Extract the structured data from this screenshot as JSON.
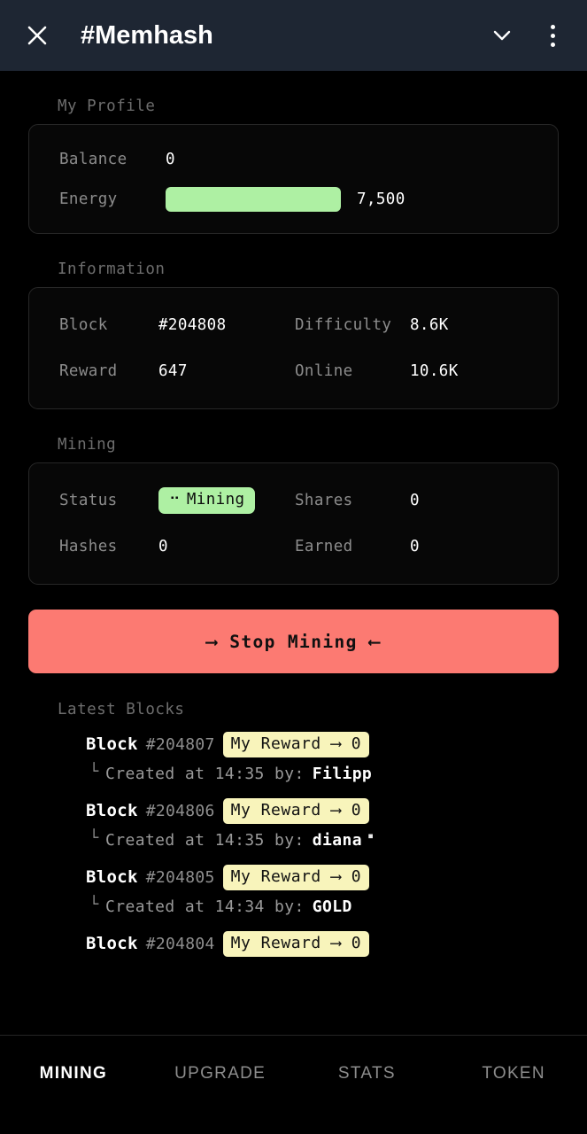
{
  "header": {
    "title": "#Memhash",
    "close_icon": "close-icon",
    "chevron_icon": "chevron-down-icon",
    "menu_icon": "more-vertical-icon"
  },
  "profile": {
    "section_title": "My Profile",
    "balance_label": "Balance",
    "balance_value": "0",
    "energy_label": "Energy",
    "energy_value": "7,500",
    "energy_percent": 100,
    "energy_bar_color": "#aef0a3"
  },
  "information": {
    "section_title": "Information",
    "block_label": "Block",
    "block_value": "#204808",
    "difficulty_label": "Difficulty",
    "difficulty_value": "8.6K",
    "reward_label": "Reward",
    "reward_value": "647",
    "online_label": "Online",
    "online_value": "10.6K"
  },
  "mining": {
    "section_title": "Mining",
    "status_label": "Status",
    "status_value": "Mining",
    "status_spinner": "⠒",
    "status_color": "#aef0a3",
    "shares_label": "Shares",
    "shares_value": "0",
    "hashes_label": "Hashes",
    "hashes_value": "0",
    "earned_label": "Earned",
    "earned_value": "0"
  },
  "action": {
    "stop_label": "⟶ Stop Mining ⟵",
    "stop_color": "#fc7a72"
  },
  "latest_blocks": {
    "section_title": "Latest Blocks",
    "badge_color": "#f8f4bb",
    "items": [
      {
        "block_word": "Block",
        "number": "#204807",
        "reward_badge": "My Reward ⟶ 0",
        "corner": "└",
        "created": "Created at 14:35 by:",
        "author": "Filipp",
        "emoji": ""
      },
      {
        "block_word": "Block",
        "number": "#204806",
        "reward_badge": "My Reward ⟶ 0",
        "corner": "└",
        "created": "Created at 14:35 by:",
        "author": "diana",
        "emoji": "▪"
      },
      {
        "block_word": "Block",
        "number": "#204805",
        "reward_badge": "My Reward ⟶ 0",
        "corner": "└",
        "created": "Created at 14:34 by:",
        "author": "GOLD",
        "emoji": ""
      },
      {
        "block_word": "Block",
        "number": "#204804",
        "reward_badge": "My Reward ⟶ 0",
        "corner": "└",
        "created": "",
        "author": "",
        "emoji": ""
      }
    ]
  },
  "bottom_nav": {
    "items": [
      {
        "label": "MINING",
        "active": true
      },
      {
        "label": "UPGRADE",
        "active": false
      },
      {
        "label": "STATS",
        "active": false
      },
      {
        "label": "TOKEN",
        "active": false
      }
    ]
  }
}
